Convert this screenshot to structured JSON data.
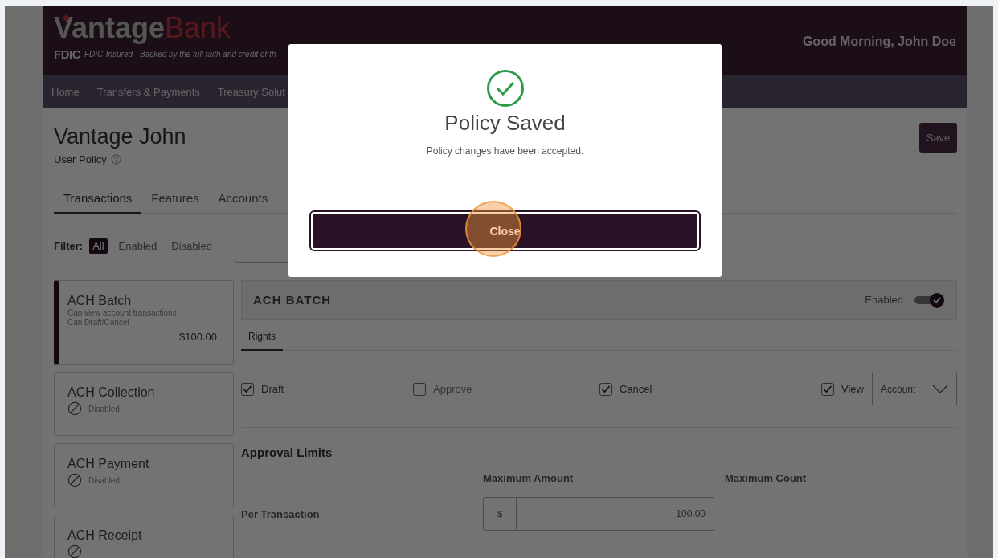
{
  "header": {
    "logo": {
      "primary": "Vantage",
      "secondary": "Bank"
    },
    "fdic_label": "FDIC",
    "fdic_text": "FDIC-Insured - Backed by the full faith and credit of th",
    "greeting": "Good Morning, John Doe"
  },
  "nav": [
    {
      "label": "Home"
    },
    {
      "label": "Transfers & Payments"
    },
    {
      "label": "Treasury Solut"
    }
  ],
  "page": {
    "title": "Vantage John",
    "subtitle": "User Policy",
    "save_button": "Save"
  },
  "tabs": [
    {
      "label": "Transactions",
      "selected": true
    },
    {
      "label": "Features",
      "selected": false
    },
    {
      "label": "Accounts",
      "selected": false
    }
  ],
  "filter": {
    "label": "Filter:",
    "options": [
      {
        "label": "All",
        "selected": true
      },
      {
        "label": "Enabled",
        "selected": false
      },
      {
        "label": "Disabled",
        "selected": false
      }
    ]
  },
  "transactions": [
    {
      "name": "ACH Batch",
      "selected": true,
      "disabled": false,
      "details": [
        "Can view account transactions",
        "Can Draft/Cancel"
      ],
      "amount": "$100.00"
    },
    {
      "name": "ACH Collection",
      "selected": false,
      "disabled": true,
      "status": "Disabled"
    },
    {
      "name": "ACH Payment",
      "selected": false,
      "disabled": true,
      "status": "Disabled"
    },
    {
      "name": "ACH Receipt",
      "selected": false,
      "disabled": true
    }
  ],
  "detail": {
    "title": "ACH BATCH",
    "enabled_label": "Enabled",
    "enabled": true,
    "tabs": [
      {
        "label": "Rights",
        "selected": true
      }
    ],
    "rights": [
      {
        "label": "Draft",
        "checked": true
      },
      {
        "label": "Approve",
        "checked": false
      },
      {
        "label": "Cancel",
        "checked": true
      },
      {
        "label": "View",
        "checked": true
      }
    ],
    "view_scope": "Account",
    "approval_limits": {
      "title": "Approval Limits",
      "columns": [
        "Maximum Amount",
        "Maximum Count"
      ],
      "rows": [
        {
          "label": "Per Transaction",
          "currency": "$",
          "amount": "100.00"
        }
      ]
    }
  },
  "modal": {
    "title": "Policy Saved",
    "message": "Policy changes have been accepted.",
    "button": "Close"
  }
}
